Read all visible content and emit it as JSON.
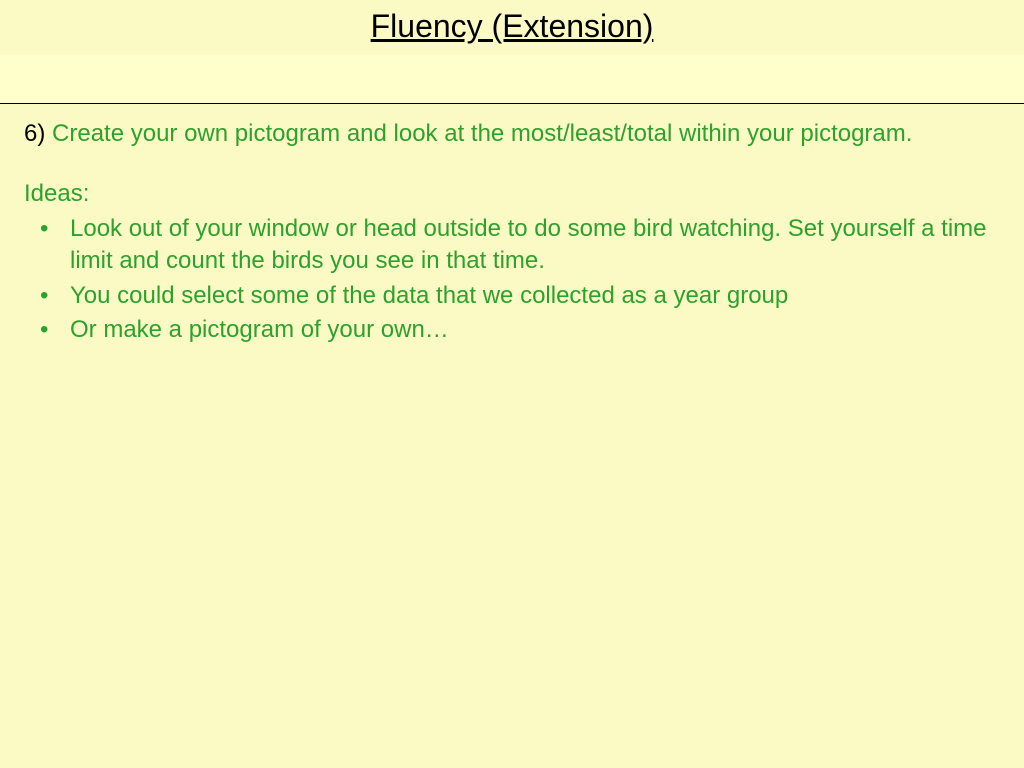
{
  "title": "Fluency (Extension)",
  "question": {
    "number": "6)",
    "text": "Create your own pictogram and look at the most/least/total within your pictogram."
  },
  "ideas_label": "Ideas:",
  "ideas": [
    "Look out of your window or head outside to do some bird watching. Set yourself a time limit and count the birds you see in that time.",
    "You could select some of the data that we collected as a year group",
    "Or make a pictogram of your own…"
  ]
}
